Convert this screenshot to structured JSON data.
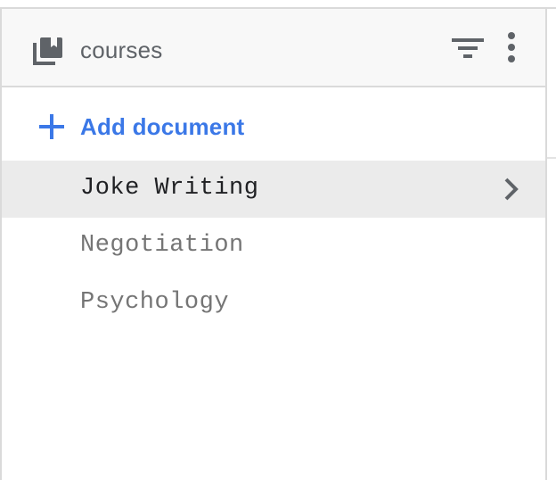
{
  "collection": {
    "title": "courses",
    "icon": "collections-icon"
  },
  "toolbar": {
    "filter_icon": "filter-icon",
    "more_icon": "more-vert-icon"
  },
  "add_document": {
    "label": "Add document",
    "icon": "plus-icon",
    "color": "#3b78e7"
  },
  "documents": [
    {
      "label": "Joke Writing",
      "selected": true
    },
    {
      "label": "Negotiation",
      "selected": false
    },
    {
      "label": "Psychology",
      "selected": false
    }
  ],
  "colors": {
    "selected_row": "#ebebeb",
    "header_bg": "#f8f8f8",
    "border": "#dadada"
  }
}
